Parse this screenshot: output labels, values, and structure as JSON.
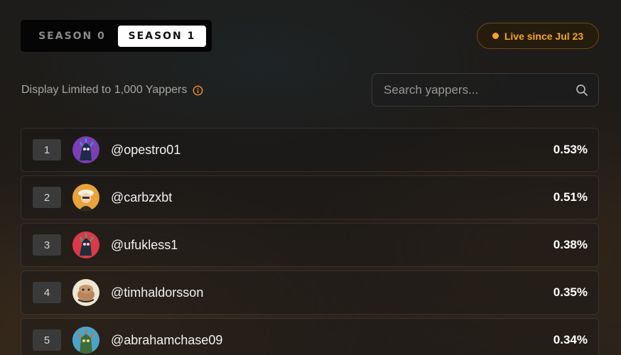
{
  "season_tabs": [
    {
      "label": "SEASON 0",
      "active": false
    },
    {
      "label": "SEASON 1",
      "active": true
    }
  ],
  "live_badge": {
    "label": "Live since Jul 23",
    "color": "#f5a524"
  },
  "limit_note": {
    "text": "Display Limited to 1,000 Yappers",
    "icon": "info-icon"
  },
  "search": {
    "placeholder": "Search yappers...",
    "value": "",
    "icon": "search-icon"
  },
  "leaderboard": [
    {
      "rank": "1",
      "handle": "@opestro01",
      "percent": "0.53%",
      "avatar_bg": "#7b3fb3"
    },
    {
      "rank": "2",
      "handle": "@carbzxbt",
      "percent": "0.51%",
      "avatar_bg": "#e8a33a"
    },
    {
      "rank": "3",
      "handle": "@ufukless1",
      "percent": "0.38%",
      "avatar_bg": "#d9394a"
    },
    {
      "rank": "4",
      "handle": "@timhaldorsson",
      "percent": "0.35%",
      "avatar_bg": "#efe6d2"
    },
    {
      "rank": "5",
      "handle": "@abrahamchase09",
      "percent": "0.34%",
      "avatar_bg": "#d96a2e"
    }
  ]
}
